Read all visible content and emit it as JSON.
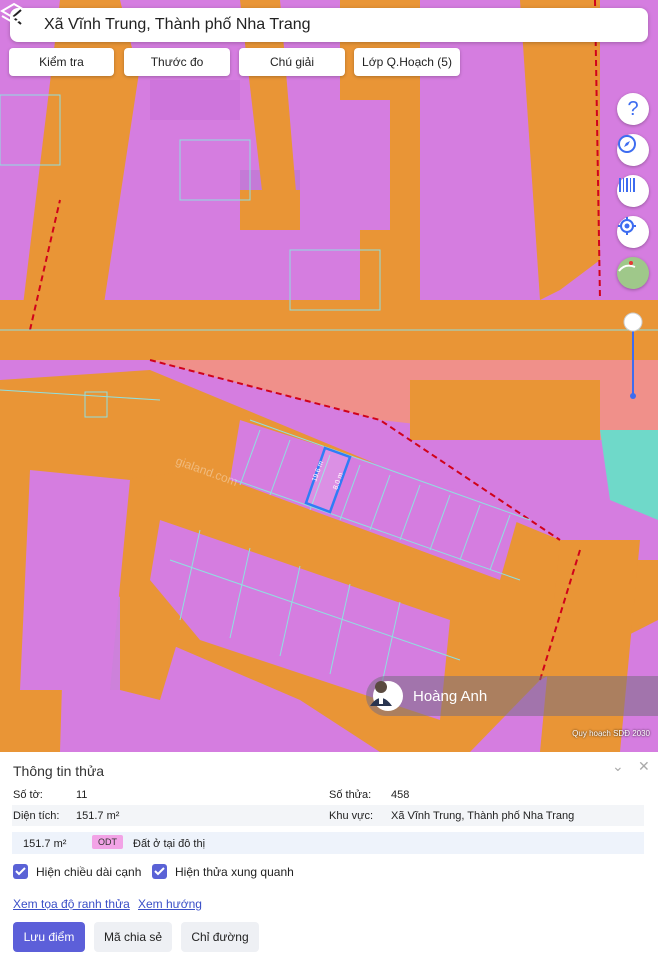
{
  "header": {
    "title": "Xã Vĩnh Trung, Thành phố Nha Trang"
  },
  "tabs": [
    {
      "label": "Kiểm tra"
    },
    {
      "label": "Thước đo"
    },
    {
      "label": "Chú giải"
    },
    {
      "label": "Lớp Q.Hoạch (5)"
    }
  ],
  "map": {
    "controls": [
      "help-icon",
      "compass-icon",
      "barcode-icon",
      "locate-icon",
      "satellite-layer-icon"
    ],
    "zoom_level": 0.3,
    "parcel_dims": [
      "19.6 m",
      "8.0 m"
    ],
    "watermark": "gialand.com",
    "credit": "Quy hoạch SDĐ 2030",
    "agent_name": "Hoàng Anh",
    "colors": {
      "residential": "#e07ae8",
      "road": "#e99536",
      "public": "#f0908a",
      "green": "#6fd9c9",
      "parcel_lines": "#8fe0e0",
      "boundary": "#d0021b"
    }
  },
  "panel": {
    "title": "Thông tin thửa",
    "so_to_label": "Số tờ:",
    "so_to_value": "11",
    "so_thua_label": "Số thửa:",
    "so_thua_value": "458",
    "dien_tich_label": "Diện tích:",
    "dien_tich_value": "151.7 m²",
    "khu_vuc_label": "Khu vực:",
    "khu_vuc_value": "Xã Vĩnh Trung, Thành phố Nha Trang",
    "land_area": "151.7 m²",
    "land_code": "ODT",
    "land_desc": "Đất ở tại đô thị",
    "check1": "Hiện chiều dài cạnh",
    "check2": "Hiện thửa xung quanh",
    "link1": "Xem tọa độ ranh thửa",
    "link2": "Xem hướng",
    "btn_save": "Lưu điểm",
    "btn_share": "Mã chia sẻ",
    "btn_route": "Chỉ đường"
  }
}
